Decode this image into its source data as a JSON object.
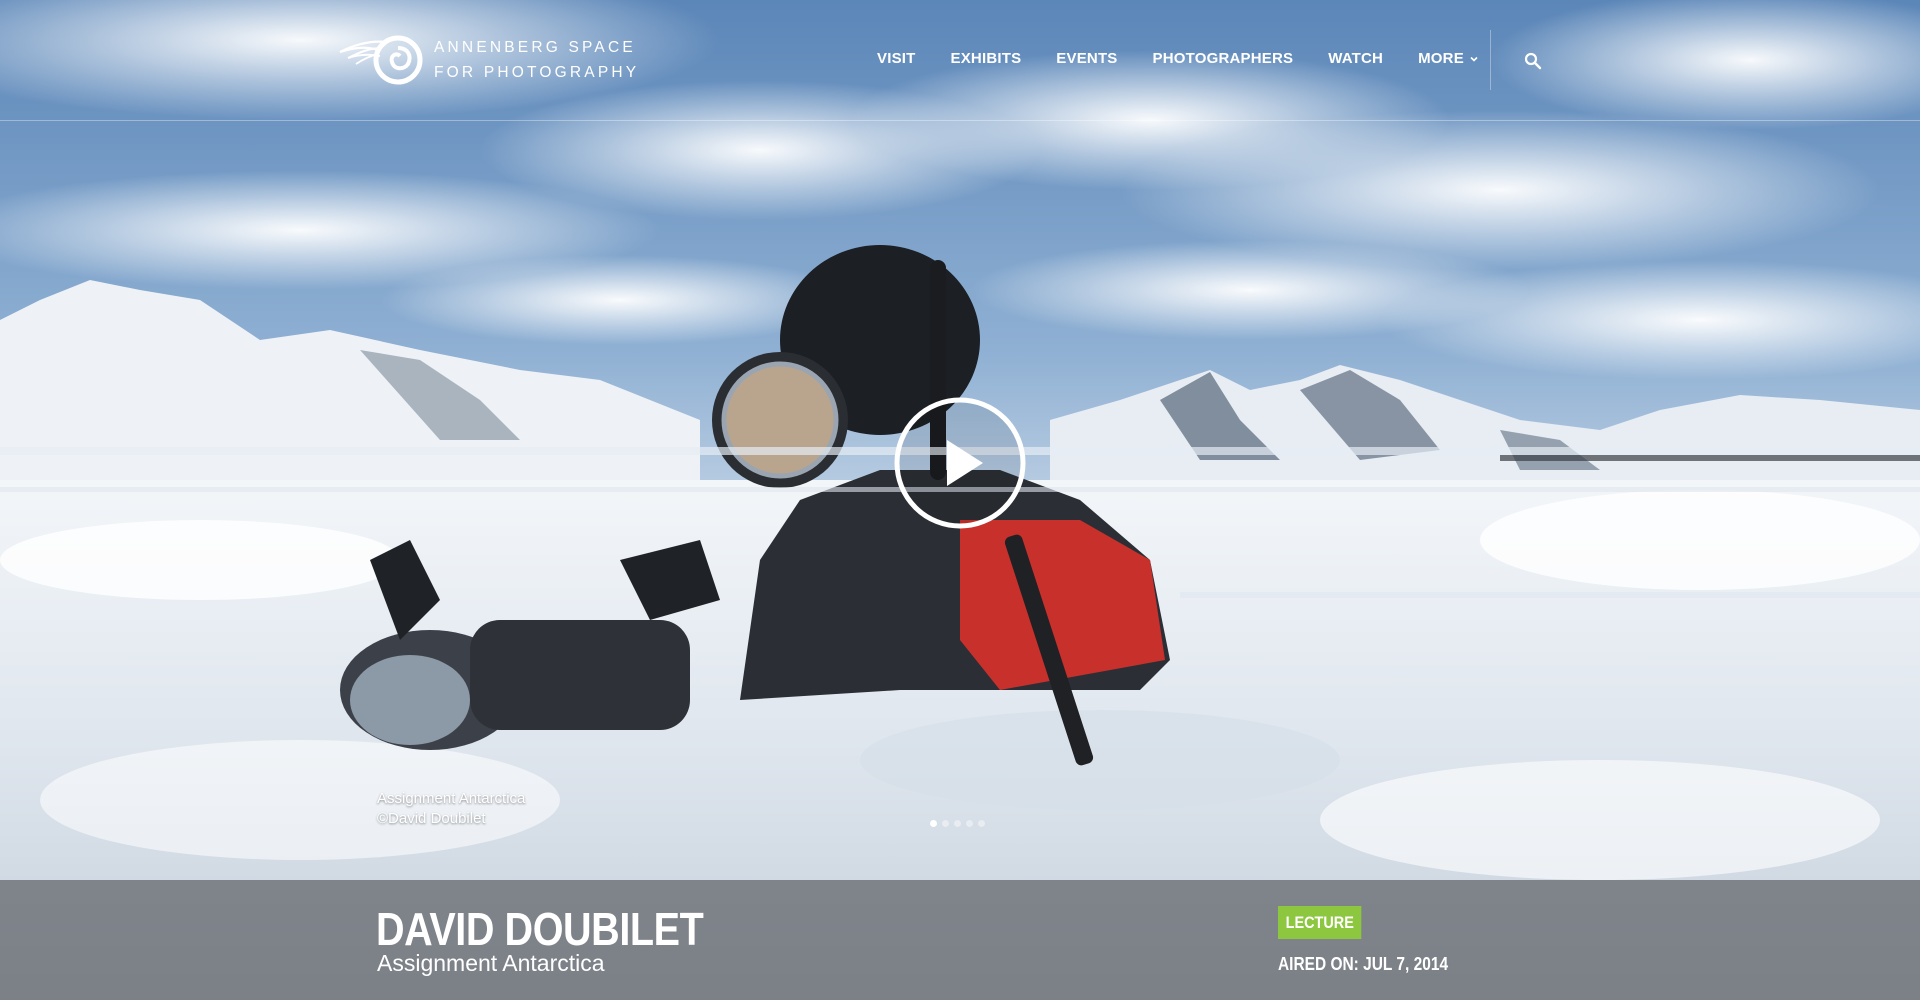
{
  "site": {
    "logo_line1": "ANNENBERG SPACE",
    "logo_line2": "FOR PHOTOGRAPHY"
  },
  "nav": {
    "items": [
      {
        "label": "VISIT"
      },
      {
        "label": "EXHIBITS"
      },
      {
        "label": "EVENTS"
      },
      {
        "label": "PHOTOGRAPHERS"
      },
      {
        "label": "WATCH"
      },
      {
        "label": "MORE"
      }
    ],
    "icons": {
      "more": "chevron-down-icon",
      "search": "search-icon"
    }
  },
  "hero": {
    "caption_title": "Assignment Antarctica",
    "caption_credit": "©David Doubilet",
    "play_icon": "play-icon",
    "slides_total": 5,
    "slide_active": 1
  },
  "event": {
    "title": "DAVID DOUBILET",
    "subtitle": "Assignment Antarctica",
    "badge": "LECTURE",
    "aired": "AIRED ON: JUL 7, 2014"
  },
  "colors": {
    "badge": "#8dc63f",
    "bar": "#5f6268"
  }
}
